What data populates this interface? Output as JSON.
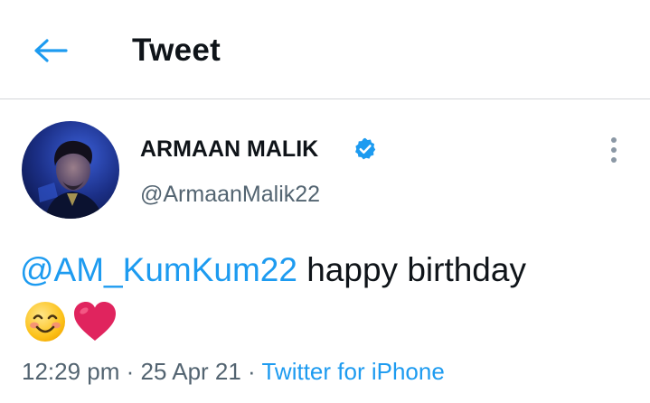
{
  "header": {
    "back_icon": "arrow-left-icon",
    "title": "Tweet"
  },
  "colors": {
    "accent": "#1d9bf0",
    "text": "#0f1419",
    "secondary": "#536471",
    "divider": "#d3d6d9",
    "heart": "#e0245e"
  },
  "tweet": {
    "author": {
      "name": "ARMAAN MALIK",
      "verified": true,
      "handle": "@ArmaanMalik22"
    },
    "mention": "@AM_KumKum22",
    "text": " happy birthday",
    "emojis": [
      "smiling-face-emoji",
      "red-heart-emoji"
    ],
    "time": "12:29 pm",
    "separator1": " · ",
    "date": "25 Apr 21",
    "separator2": " · ",
    "source": "Twitter for iPhone"
  }
}
